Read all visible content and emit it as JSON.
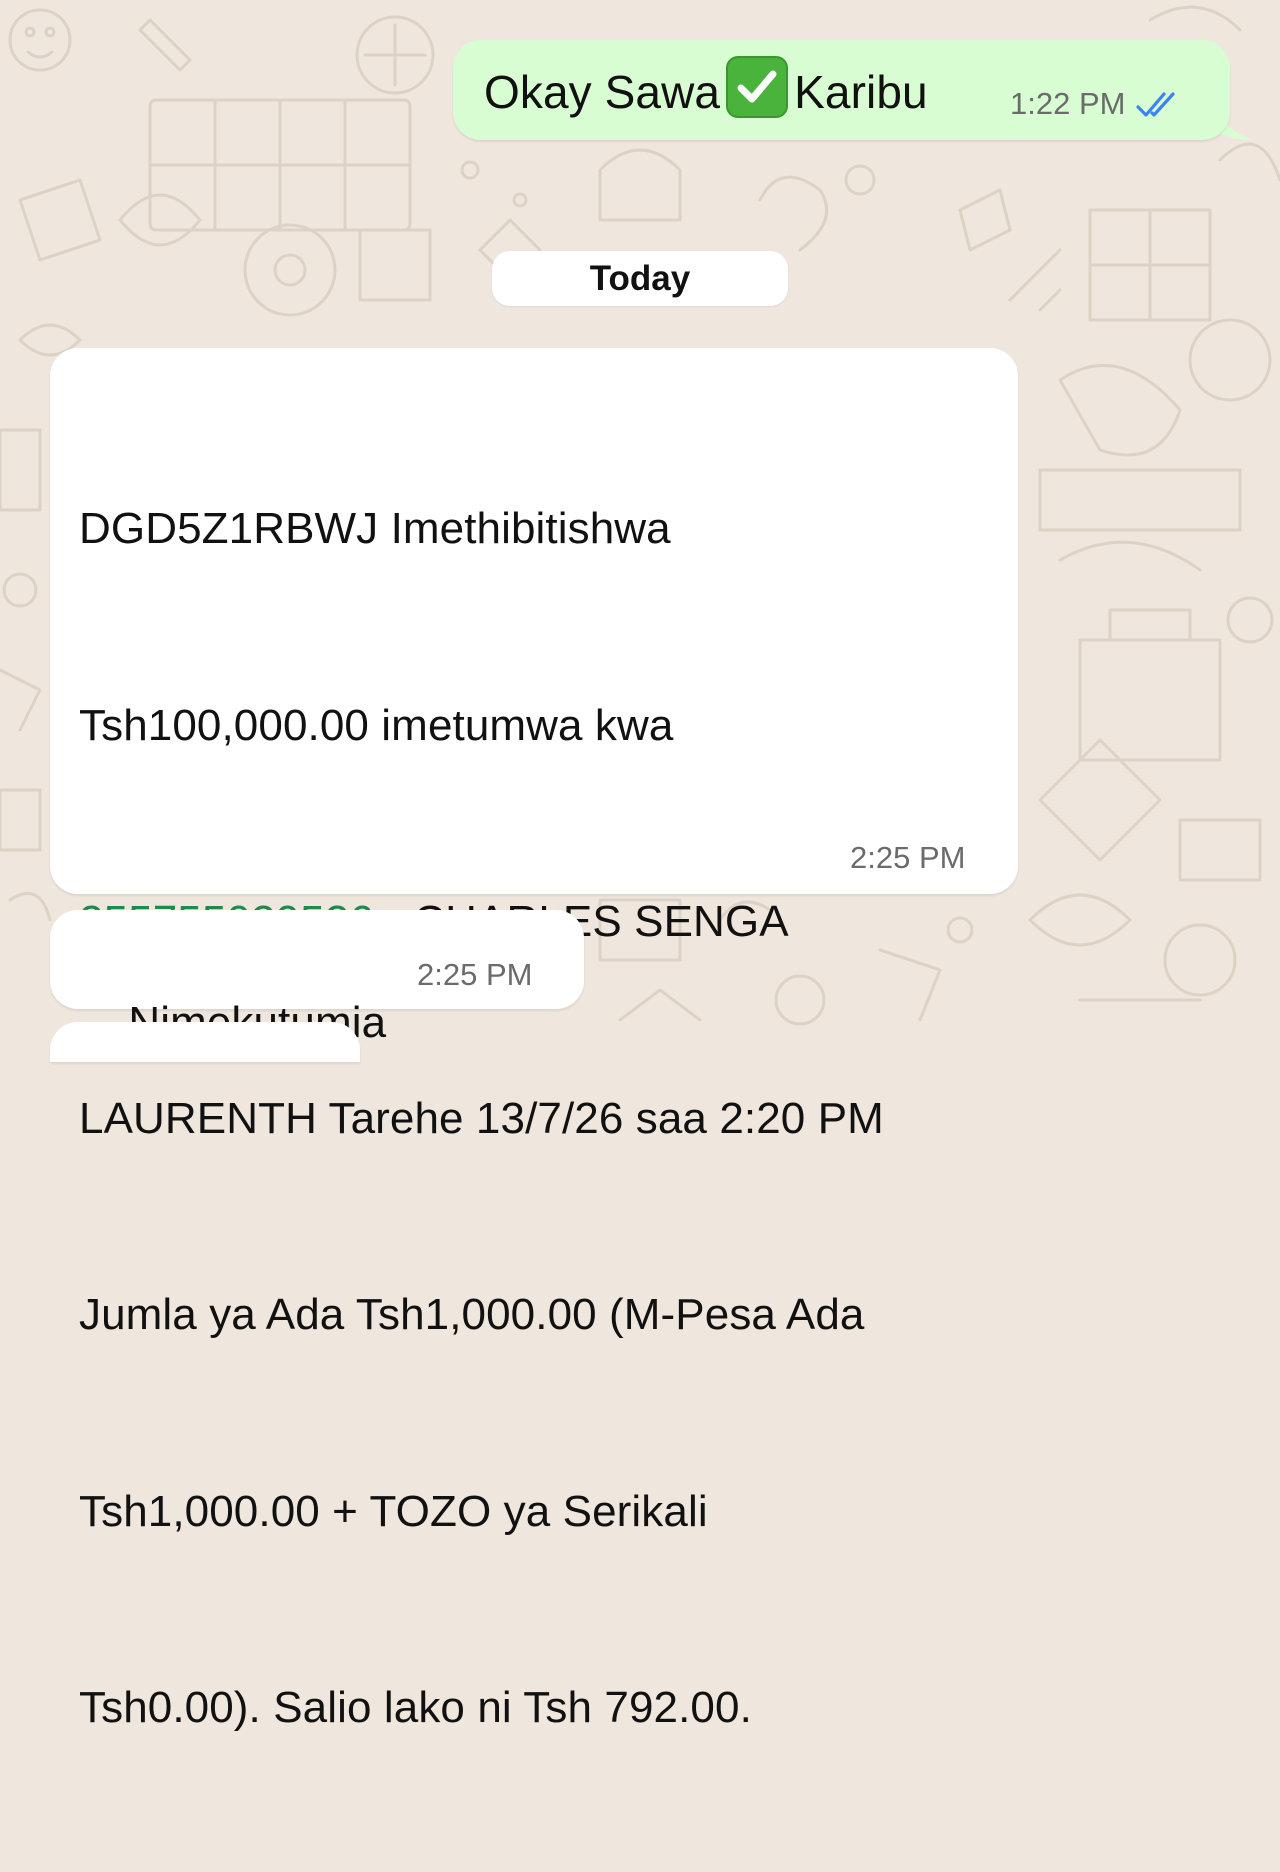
{
  "chat": {
    "date_separator": "Today",
    "messages": [
      {
        "direction": "outgoing",
        "text_before": "Okay Sawa",
        "emoji": "check-mark-button-emoji",
        "text_after": "Karibu",
        "time": "1:22 PM",
        "status": "read"
      },
      {
        "direction": "incoming",
        "lines": [
          "DGD5Z1RBWJ Imethibitishwa",
          "Tsh100,000.00 imetumwa kwa"
        ],
        "link_phone": "255755029526",
        "after_link": " - CHARLES SENGA",
        "rest_lines": [
          "LAURENTH Tarehe 13/7/26 saa 2:20 PM",
          "Jumla ya Ada Tsh1,000.00 (M-Pesa Ada",
          "Tsh1,000.00 + TOZO ya Serikali",
          "Tsh0.00). Salio lako ni Tsh 792.00."
        ],
        "time": "2:25 PM"
      },
      {
        "direction": "incoming",
        "text": "Nimekutumia",
        "time": "2:25 PM"
      }
    ]
  },
  "colors": {
    "wallpaper": "#efe7de",
    "outgoing_bubble": "#d9fdd3",
    "incoming_bubble": "#ffffff",
    "link": "#1f8a4c",
    "read_ticks": "#3b82f6",
    "timestamp": "#6b6b6b"
  }
}
